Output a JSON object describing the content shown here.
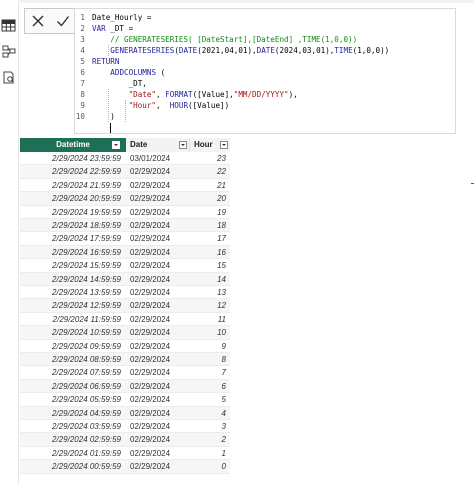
{
  "editor": {
    "lines": [
      {
        "num": "1",
        "segments": [
          {
            "t": "Date_Hourly =",
            "c": ""
          }
        ]
      },
      {
        "num": "2",
        "segments": [
          {
            "t": "VAR",
            "c": "kw"
          },
          {
            "t": " _DT =",
            "c": ""
          }
        ]
      },
      {
        "num": "3",
        "segments": [
          {
            "t": "    // GENERATESERIES( [DateStart],[DateEnd] ,TIME(1,0,0))",
            "c": "cm"
          }
        ]
      },
      {
        "num": "4",
        "segments": [
          {
            "t": "    ",
            "c": ""
          },
          {
            "t": "GENERATESERIES",
            "c": "fn"
          },
          {
            "t": "(",
            "c": ""
          },
          {
            "t": "DATE",
            "c": "fn"
          },
          {
            "t": "(2021,04,01),",
            "c": ""
          },
          {
            "t": "DATE",
            "c": "fn"
          },
          {
            "t": "(2024,03,01),",
            "c": ""
          },
          {
            "t": "TIME",
            "c": "fn"
          },
          {
            "t": "(1,0,0))",
            "c": ""
          }
        ]
      },
      {
        "num": "5",
        "segments": [
          {
            "t": "RETURN",
            "c": "kw"
          }
        ]
      },
      {
        "num": "6",
        "segments": [
          {
            "t": "    ",
            "c": ""
          },
          {
            "t": "ADDCOLUMNS",
            "c": "fn"
          },
          {
            "t": " (",
            "c": ""
          }
        ]
      },
      {
        "num": "7",
        "segments": [
          {
            "t": "        _DT,",
            "c": ""
          }
        ]
      },
      {
        "num": "8",
        "segments": [
          {
            "t": "        ",
            "c": ""
          },
          {
            "t": "\"Date\"",
            "c": "st"
          },
          {
            "t": ", ",
            "c": ""
          },
          {
            "t": "FORMAT",
            "c": "fn"
          },
          {
            "t": "([Value],",
            "c": ""
          },
          {
            "t": "\"MM/DD/YYYY\"",
            "c": "st"
          },
          {
            "t": "),",
            "c": ""
          }
        ]
      },
      {
        "num": "9",
        "segments": [
          {
            "t": "        ",
            "c": ""
          },
          {
            "t": "\"Hour\"",
            "c": "st"
          },
          {
            "t": ",  ",
            "c": ""
          },
          {
            "t": "HOUR",
            "c": "fn"
          },
          {
            "t": "([Value])",
            "c": ""
          }
        ]
      },
      {
        "num": "10",
        "segments": [
          {
            "t": "    )",
            "c": ""
          }
        ]
      }
    ]
  },
  "table": {
    "columns": [
      "Datetime",
      "Date",
      "Hour"
    ],
    "rows": [
      [
        "2/29/2024 23:59:59",
        "03/01/2024",
        "23"
      ],
      [
        "2/29/2024 22:59:59",
        "02/29/2024",
        "22"
      ],
      [
        "2/29/2024 21:59:59",
        "02/29/2024",
        "21"
      ],
      [
        "2/29/2024 20:59:59",
        "02/29/2024",
        "20"
      ],
      [
        "2/29/2024 19:59:59",
        "02/29/2024",
        "19"
      ],
      [
        "2/29/2024 18:59:59",
        "02/29/2024",
        "18"
      ],
      [
        "2/29/2024 17:59:59",
        "02/29/2024",
        "17"
      ],
      [
        "2/29/2024 16:59:59",
        "02/29/2024",
        "16"
      ],
      [
        "2/29/2024 15:59:59",
        "02/29/2024",
        "15"
      ],
      [
        "2/29/2024 14:59:59",
        "02/29/2024",
        "14"
      ],
      [
        "2/29/2024 13:59:59",
        "02/29/2024",
        "13"
      ],
      [
        "2/29/2024 12:59:59",
        "02/29/2024",
        "12"
      ],
      [
        "2/29/2024 11:59:59",
        "02/29/2024",
        "11"
      ],
      [
        "2/29/2024 10:59:59",
        "02/29/2024",
        "10"
      ],
      [
        "2/29/2024 09:59:59",
        "02/29/2024",
        "9"
      ],
      [
        "2/29/2024 08:59:59",
        "02/29/2024",
        "8"
      ],
      [
        "2/29/2024 07:59:59",
        "02/29/2024",
        "7"
      ],
      [
        "2/29/2024 06:59:59",
        "02/29/2024",
        "6"
      ],
      [
        "2/29/2024 05:59:59",
        "02/29/2024",
        "5"
      ],
      [
        "2/29/2024 04:59:59",
        "02/29/2024",
        "4"
      ],
      [
        "2/29/2024 03:59:59",
        "02/29/2024",
        "3"
      ],
      [
        "2/29/2024 02:59:59",
        "02/29/2024",
        "2"
      ],
      [
        "2/29/2024 01:59:59",
        "02/29/2024",
        "1"
      ],
      [
        "2/29/2024 00:59:59",
        "02/29/2024",
        "0"
      ]
    ]
  },
  "colors": {
    "header_active": "#1e6f58",
    "keyword": "#1f1f9a",
    "comment": "#138a13",
    "string": "#a31515"
  }
}
